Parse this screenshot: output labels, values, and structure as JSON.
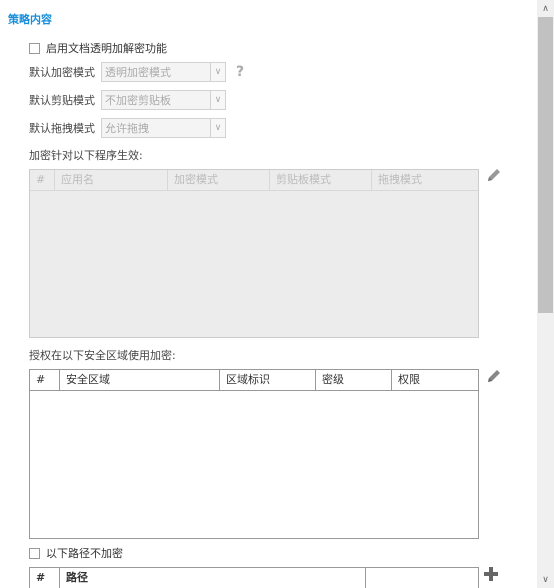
{
  "section": {
    "title": "策略内容"
  },
  "enable_transparent": {
    "label": "启用文档透明加解密功能"
  },
  "defaults": {
    "encrypt_mode": {
      "label": "默认加密模式",
      "value": "透明加密模式"
    },
    "clipboard_mode": {
      "label": "默认剪贴模式",
      "value": "不加密剪贴板"
    },
    "drag_mode": {
      "label": "默认拖拽模式",
      "value": "允许拖拽"
    },
    "help_symbol": "?"
  },
  "program_table": {
    "label": "加密针对以下程序生效:",
    "columns": [
      "#",
      "应用名",
      "加密模式",
      "剪贴板模式",
      "拖拽模式"
    ]
  },
  "zone_table": {
    "label": "授权在以下安全区域使用加密:",
    "columns": [
      "#",
      "安全区域",
      "区域标识",
      "密级",
      "权限"
    ]
  },
  "path_exclude": {
    "label": "以下路径不加密"
  },
  "path_table": {
    "columns": [
      "#",
      "路径"
    ]
  },
  "icons": {
    "edit": "pencil-icon",
    "add": "plus-icon"
  },
  "colors": {
    "accent": "#1a8fd9",
    "disabled_bg": "#ececec"
  }
}
